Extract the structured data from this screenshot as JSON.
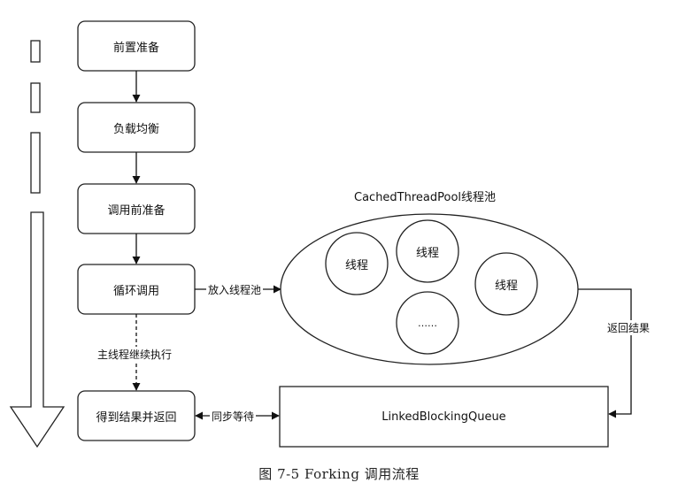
{
  "diagram": {
    "steps": [
      "前置准备",
      "负载均衡",
      "调用前准备",
      "循环调用",
      "得到结果并返回"
    ],
    "pool": {
      "title": "CachedThreadPool线程池",
      "threads": [
        "线程",
        "线程",
        "线程",
        "……"
      ]
    },
    "queue": "LinkedBlockingQueue",
    "edges": {
      "to_pool": "放入线程池",
      "return_result": "返回结果",
      "main_continue": "主线程继续执行",
      "sync_wait": "同步等待"
    }
  },
  "caption": "图 7-5   Forking 调用流程"
}
